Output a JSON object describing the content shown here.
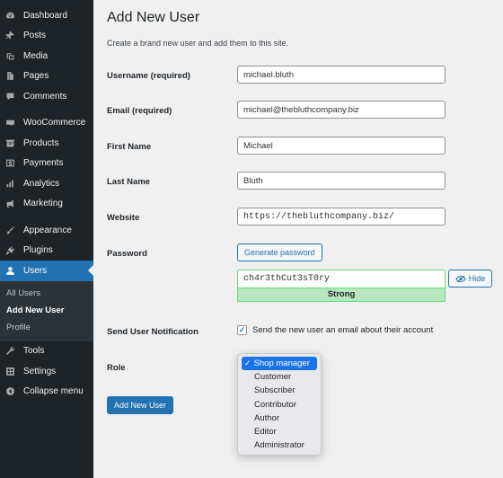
{
  "sidebar": {
    "items": [
      {
        "label": "Dashboard",
        "icon": "dashboard-icon"
      },
      {
        "label": "Posts",
        "icon": "pin-icon"
      },
      {
        "label": "Media",
        "icon": "media-icon"
      },
      {
        "label": "Pages",
        "icon": "pages-icon"
      },
      {
        "label": "Comments",
        "icon": "comment-icon"
      },
      {
        "label": "WooCommerce",
        "icon": "woo-icon"
      },
      {
        "label": "Products",
        "icon": "archive-icon"
      },
      {
        "label": "Payments",
        "icon": "dollar-icon"
      },
      {
        "label": "Analytics",
        "icon": "bar-chart-icon"
      },
      {
        "label": "Marketing",
        "icon": "megaphone-icon"
      },
      {
        "label": "Appearance",
        "icon": "brush-icon"
      },
      {
        "label": "Plugins",
        "icon": "plug-icon"
      },
      {
        "label": "Users",
        "icon": "user-icon"
      },
      {
        "label": "Tools",
        "icon": "wrench-icon"
      },
      {
        "label": "Settings",
        "icon": "settings-icon"
      },
      {
        "label": "Collapse menu",
        "icon": "collapse-icon"
      }
    ],
    "submenu": [
      "All Users",
      "Add New User",
      "Profile"
    ],
    "active_color": "#2271b1"
  },
  "page": {
    "title": "Add New User",
    "description": "Create a brand new user and add them to this site."
  },
  "form": {
    "username": {
      "label": "Username (required)",
      "value": "michael.bluth"
    },
    "email": {
      "label": "Email (required)",
      "value": "michael@thebluthcompany.biz"
    },
    "first_name": {
      "label": "First Name",
      "value": "Michael"
    },
    "last_name": {
      "label": "Last Name",
      "value": "Bluth"
    },
    "website": {
      "label": "Website",
      "value": "https://thebluthcompany.biz/"
    },
    "password": {
      "label": "Password",
      "generate_label": "Generate password",
      "value": "ch4r3thCut3sT0ry",
      "strength": "Strong",
      "hide_label": "Hide"
    },
    "notification": {
      "label": "Send User Notification",
      "text": "Send the new user an email about their account",
      "checked": true
    },
    "role": {
      "label": "Role",
      "selected": "Shop manager",
      "options": [
        "Shop manager",
        "Customer",
        "Subscriber",
        "Contributor",
        "Author",
        "Editor",
        "Administrator"
      ]
    },
    "submit_label": "Add New User"
  }
}
